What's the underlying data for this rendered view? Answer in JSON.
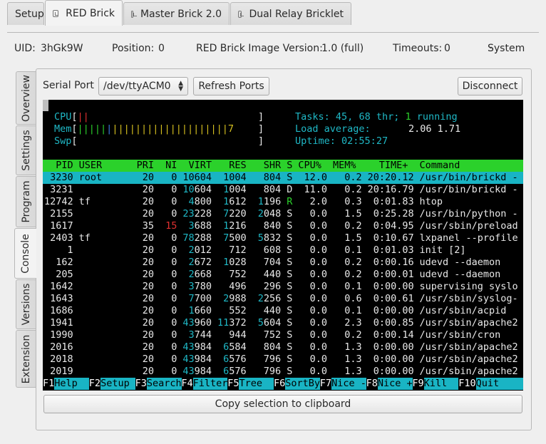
{
  "top_tabs": [
    {
      "label": "Setup",
      "active": false,
      "icon": null
    },
    {
      "label": "RED Brick",
      "active": true,
      "icon": "brick-icon"
    },
    {
      "label": "Master Brick 2.0",
      "active": false,
      "icon": "brick-icon"
    },
    {
      "label": "Dual Relay Bricklet",
      "active": false,
      "icon": "brick-icon"
    }
  ],
  "info": {
    "uid_label": "UID:",
    "uid": "3hGk9W",
    "position_label": "Position:",
    "position": "0",
    "image_label": "RED Brick Image Version:",
    "image": "1.0 (full)",
    "timeouts_label": "Timeouts:",
    "timeouts": "0",
    "system_menu": "System"
  },
  "side_tabs": [
    "Overview",
    "Settings",
    "Program",
    "Console",
    "Versions",
    "Extension"
  ],
  "active_side_tab": "Console",
  "console": {
    "serial_port_label": "Serial Port",
    "serial_port_value": "/dev/ttyACM0",
    "refresh_label": "Refresh Ports",
    "disconnect_label": "Disconnect",
    "copy_label": "Copy selection to clipboard"
  },
  "htop": {
    "cpu_label": "CPU",
    "mem_label": "Mem",
    "swp_label": "Swp",
    "mem_suffix": "7",
    "tasks_label": "Tasks:",
    "tasks_value": "45,",
    "thr_value": "68 thr;",
    "running_value": "1",
    "running_label": "running",
    "load_label": "Load average:",
    "load_value": "2.06 1.71",
    "uptime_label": "Uptime:",
    "uptime_value": "02:55:27",
    "columns": [
      "PID",
      "USER",
      "PRI",
      "NI",
      "VIRT",
      "RES",
      "SHR",
      "S",
      "CPU%",
      "MEM%",
      "TIME+",
      "Command"
    ],
    "processes": [
      {
        "pid": "3230",
        "user": "root",
        "pri": "20",
        "ni": "0",
        "virt": "10604",
        "res": "1004",
        "shr": "804",
        "s": "S",
        "cpu": "12.0",
        "mem": "0.2",
        "time": "20:20.12",
        "cmd": "/usr/bin/brickd -",
        "selected": true
      },
      {
        "pid": "3231",
        "user": "",
        "pri": "20",
        "ni": "0",
        "virt": "10604",
        "res": "1004",
        "shr": "804",
        "s": "D",
        "cpu": "11.0",
        "mem": "0.2",
        "time": "20:16.79",
        "cmd": "/usr/bin/brickd -"
      },
      {
        "pid": "12742",
        "user": "tf",
        "pri": "20",
        "ni": "0",
        "virt": "4800",
        "res": "1612",
        "shr": "1196",
        "s": "R",
        "cpu": "2.0",
        "mem": "0.3",
        "time": "0:01.83",
        "cmd": "htop"
      },
      {
        "pid": "2155",
        "user": "",
        "pri": "20",
        "ni": "0",
        "virt": "23228",
        "res": "7220",
        "shr": "2048",
        "s": "S",
        "cpu": "0.0",
        "mem": "1.5",
        "time": "0:25.28",
        "cmd": "/usr/bin/python -"
      },
      {
        "pid": "1617",
        "user": "",
        "pri": "35",
        "ni": "15",
        "virt": "3688",
        "res": "1216",
        "shr": "840",
        "s": "S",
        "cpu": "0.0",
        "mem": "0.2",
        "time": "0:04.95",
        "cmd": "/usr/sbin/preload"
      },
      {
        "pid": "2403",
        "user": "tf",
        "pri": "20",
        "ni": "0",
        "virt": "78288",
        "res": "7500",
        "shr": "5832",
        "s": "S",
        "cpu": "0.0",
        "mem": "1.5",
        "time": "0:10.67",
        "cmd": "lxpanel --profile"
      },
      {
        "pid": "1",
        "user": "",
        "pri": "20",
        "ni": "0",
        "virt": "2012",
        "res": "712",
        "shr": "608",
        "s": "S",
        "cpu": "0.0",
        "mem": "0.1",
        "time": "0:01.03",
        "cmd": "init [2]"
      },
      {
        "pid": "162",
        "user": "",
        "pri": "20",
        "ni": "0",
        "virt": "2672",
        "res": "1028",
        "shr": "704",
        "s": "S",
        "cpu": "0.0",
        "mem": "0.2",
        "time": "0:00.16",
        "cmd": "udevd --daemon"
      },
      {
        "pid": "205",
        "user": "",
        "pri": "20",
        "ni": "0",
        "virt": "2668",
        "res": "752",
        "shr": "440",
        "s": "S",
        "cpu": "0.0",
        "mem": "0.2",
        "time": "0:00.01",
        "cmd": "udevd --daemon"
      },
      {
        "pid": "1642",
        "user": "",
        "pri": "20",
        "ni": "0",
        "virt": "3780",
        "res": "496",
        "shr": "296",
        "s": "S",
        "cpu": "0.0",
        "mem": "0.1",
        "time": "0:00.00",
        "cmd": "supervising syslo"
      },
      {
        "pid": "1643",
        "user": "",
        "pri": "20",
        "ni": "0",
        "virt": "7700",
        "res": "2988",
        "shr": "2256",
        "s": "S",
        "cpu": "0.0",
        "mem": "0.6",
        "time": "0:00.61",
        "cmd": "/usr/sbin/syslog-"
      },
      {
        "pid": "1686",
        "user": "",
        "pri": "20",
        "ni": "0",
        "virt": "1660",
        "res": "552",
        "shr": "440",
        "s": "S",
        "cpu": "0.0",
        "mem": "0.1",
        "time": "0:00.00",
        "cmd": "/usr/sbin/acpid"
      },
      {
        "pid": "1941",
        "user": "",
        "pri": "20",
        "ni": "0",
        "virt": "43960",
        "res": "11372",
        "shr": "5604",
        "s": "S",
        "cpu": "0.0",
        "mem": "2.3",
        "time": "0:00.85",
        "cmd": "/usr/sbin/apache2"
      },
      {
        "pid": "1990",
        "user": "",
        "pri": "20",
        "ni": "0",
        "virt": "3744",
        "res": "944",
        "shr": "752",
        "s": "S",
        "cpu": "0.0",
        "mem": "0.2",
        "time": "0:00.14",
        "cmd": "/usr/sbin/cron"
      },
      {
        "pid": "2016",
        "user": "",
        "pri": "20",
        "ni": "0",
        "virt": "43984",
        "res": "6584",
        "shr": "804",
        "s": "S",
        "cpu": "0.0",
        "mem": "1.3",
        "time": "0:00.00",
        "cmd": "/usr/sbin/apache2"
      },
      {
        "pid": "2018",
        "user": "",
        "pri": "20",
        "ni": "0",
        "virt": "43984",
        "res": "6576",
        "shr": "796",
        "s": "S",
        "cpu": "0.0",
        "mem": "1.3",
        "time": "0:00.00",
        "cmd": "/usr/sbin/apache2"
      },
      {
        "pid": "2019",
        "user": "",
        "pri": "20",
        "ni": "0",
        "virt": "43984",
        "res": "6576",
        "shr": "796",
        "s": "S",
        "cpu": "0.0",
        "mem": "1.3",
        "time": "0:00.00",
        "cmd": "/usr/sbin/apache2"
      }
    ],
    "function_keys": [
      {
        "key": "F1",
        "label": "Help  "
      },
      {
        "key": "F2",
        "label": "Setup "
      },
      {
        "key": "F3",
        "label": "Search"
      },
      {
        "key": "F4",
        "label": "Filter"
      },
      {
        "key": "F5",
        "label": "Tree  "
      },
      {
        "key": "F6",
        "label": "SortBy"
      },
      {
        "key": "F7",
        "label": "Nice -"
      },
      {
        "key": "F8",
        "label": "Nice +"
      },
      {
        "key": "F9",
        "label": "Kill  "
      },
      {
        "key": "F10",
        "label": "Quit "
      }
    ]
  },
  "colors": {
    "cyan": "#1fb8c6",
    "green": "#2bd12b",
    "selection": "#19b4c4",
    "terminal_bg": "#000000"
  }
}
